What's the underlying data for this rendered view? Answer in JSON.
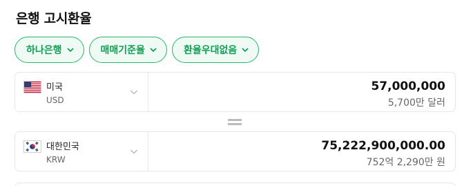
{
  "title": "은행 고시환율",
  "filters": [
    {
      "label": "하나은행"
    },
    {
      "label": "매매기준율"
    },
    {
      "label": "환율우대없음"
    }
  ],
  "from": {
    "name": "미국",
    "code": "USD",
    "flag_icon": "us-flag-icon",
    "amount": "57,000,000",
    "amount_korean": "5,700만 달러"
  },
  "to": {
    "name": "대한민국",
    "code": "KRW",
    "flag_icon": "kr-flag-icon",
    "amount": "75,222,900,000.00",
    "amount_korean": "752억 2,290만 원"
  },
  "colors": {
    "accent": "#28b46c",
    "accent_text": "#139e55",
    "chip_bg": "#eefaf3",
    "border": "#e4e6e8"
  }
}
